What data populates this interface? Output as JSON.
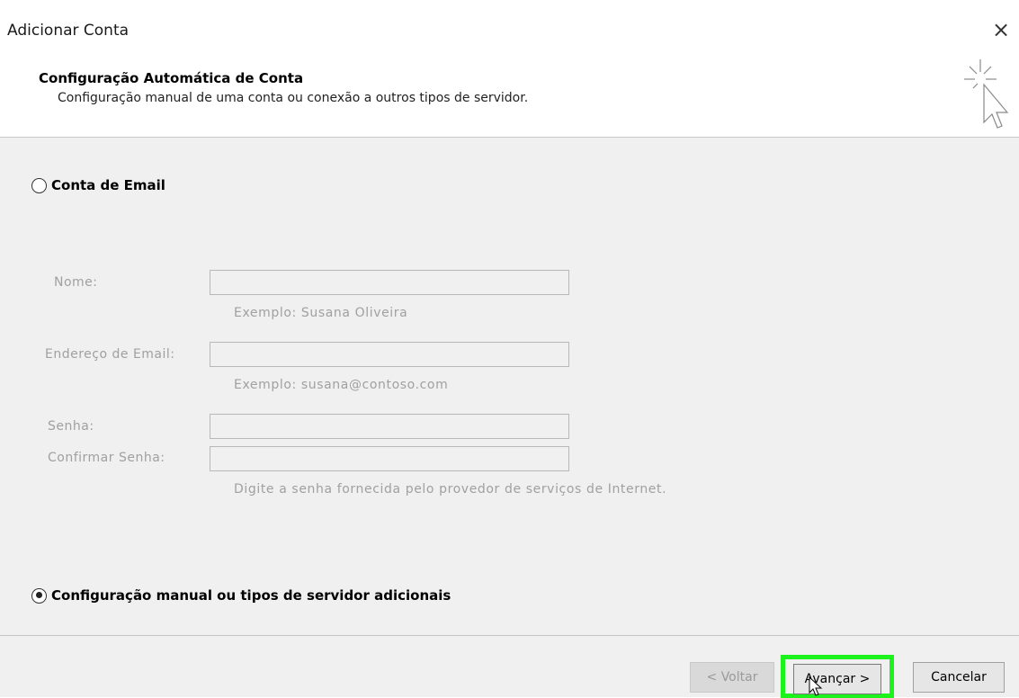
{
  "window": {
    "title": "Adicionar Conta",
    "close_glyph": "×"
  },
  "header": {
    "title": "Configuração Automática de Conta",
    "subtitle": "Configuração manual de uma conta ou conexão a outros tipos de servidor.",
    "icon": "wizard-cursor-sparkle-icon"
  },
  "email_account": {
    "radio_label": "Conta de Email",
    "checked": false,
    "name_label": "Nome:",
    "name_value": "",
    "name_hint": "Exemplo: Susana Oliveira",
    "email_label": "Endereço de Email:",
    "email_value": "",
    "email_hint": "Exemplo: susana@contoso.com",
    "password_label": "Senha:",
    "password_value": "",
    "confirm_label": "Confirmar Senha:",
    "confirm_value": "",
    "password_hint": "Digite a senha fornecida pelo provedor de serviços de Internet."
  },
  "manual_config": {
    "radio_label": "Configuração manual ou tipos de servidor adicionais",
    "checked": true
  },
  "footer": {
    "back_label": "< Voltar",
    "next_label": "Avançar >",
    "cancel_label": "Cancelar"
  },
  "colors": {
    "highlight": "#1cf21c",
    "panel_bg": "#f0f0f0",
    "disabled_text": "#a0a0a0"
  }
}
